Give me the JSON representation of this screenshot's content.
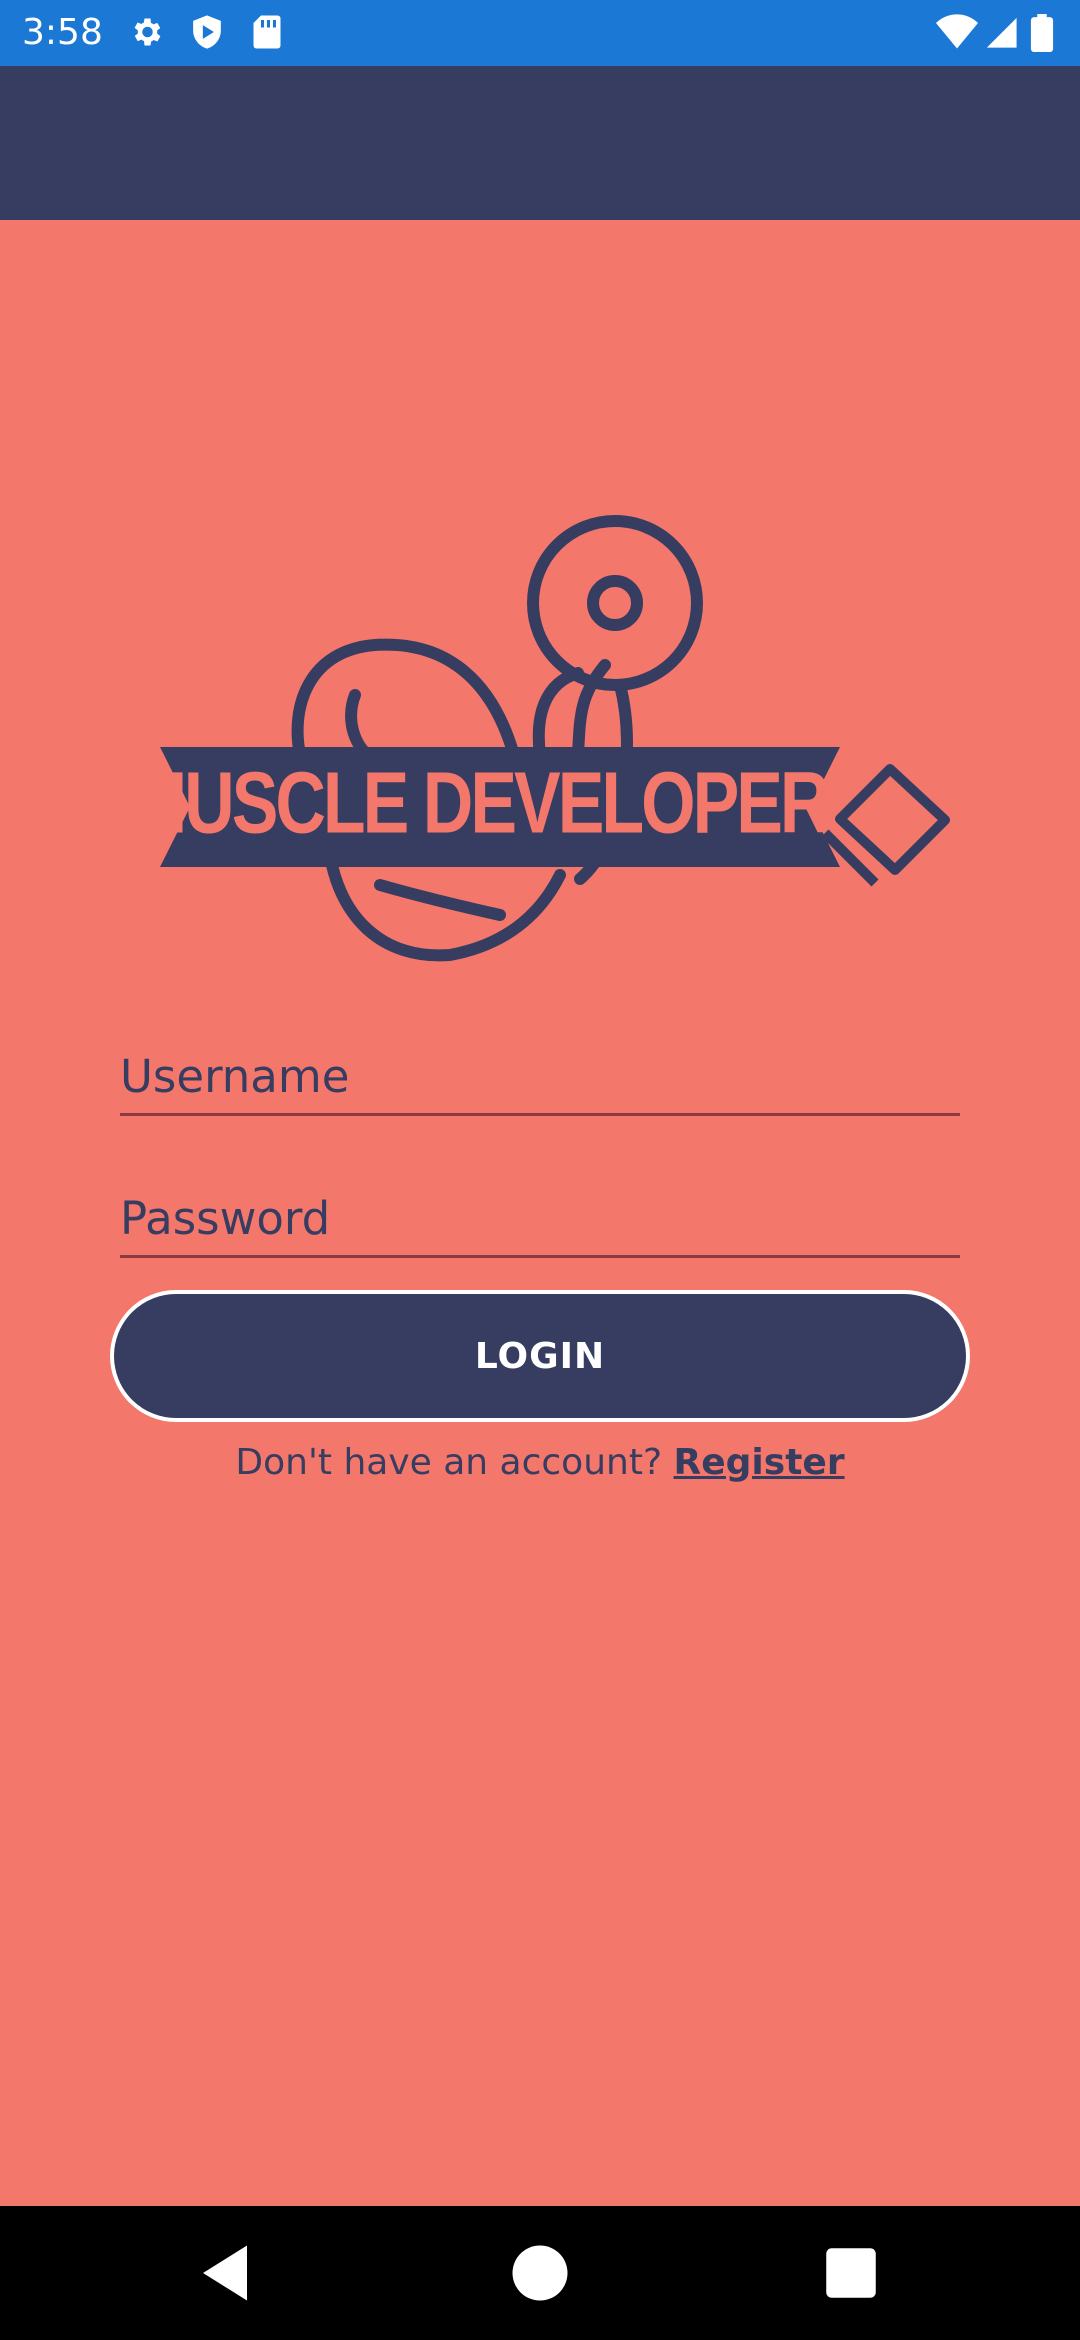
{
  "status_bar": {
    "time": "3:58",
    "left_icons": [
      "settings-icon",
      "play-protect-icon",
      "sd-card-icon"
    ],
    "right_icons": [
      "wifi-icon",
      "cellular-signal-icon",
      "battery-icon"
    ]
  },
  "logo": {
    "text": "MUSCLE DEVELOPERS",
    "colors": {
      "primary": "#363d61",
      "text": "#f4776b"
    }
  },
  "login_form": {
    "username_placeholder": "Username",
    "password_placeholder": "Password",
    "login_label": "LOGIN",
    "register_prompt": "Don't have an account?",
    "register_label": "Register"
  },
  "navigation_bar": {
    "buttons": [
      "back-icon",
      "home-icon",
      "recents-icon"
    ]
  },
  "colors": {
    "background": "#f4776b",
    "app_bar": "#363d61",
    "status_bar": "#1c78d5",
    "button": "#363d61",
    "button_border": "#ffffff"
  }
}
